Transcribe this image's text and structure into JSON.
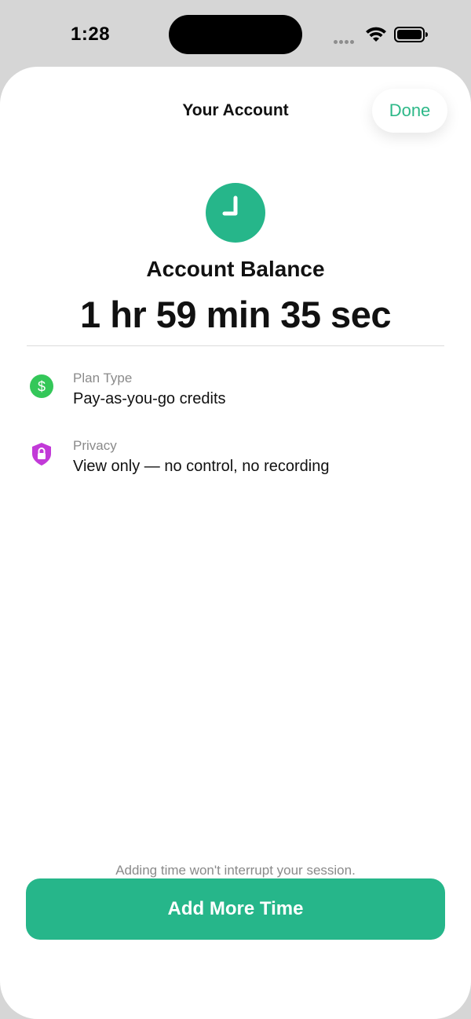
{
  "status_bar": {
    "time": "1:28",
    "icons": [
      "cellular-dots-icon",
      "wifi-icon",
      "battery-icon"
    ]
  },
  "header": {
    "title": "Your Account",
    "done_label": "Done"
  },
  "balance": {
    "icon": "clock-icon",
    "label": "Account Balance",
    "value": "1 hr 59 min 35 sec"
  },
  "details": {
    "plan": {
      "icon": "dollar-icon",
      "label": "Plan Type",
      "value": "Pay-as-you-go credits"
    },
    "privacy": {
      "icon": "lock-shield-icon",
      "label": "Privacy",
      "value": "View only — no control, no recording"
    }
  },
  "footer": {
    "note": "Adding time won't interrupt your session.",
    "button_label": "Add More Time"
  },
  "colors": {
    "accent": "#26b68a",
    "done_text": "#2db888",
    "dollar_badge": "#34c759",
    "privacy_badge": "#c23ad8",
    "secondary_text": "#8a8a8a",
    "background": "#d6d6d6"
  }
}
